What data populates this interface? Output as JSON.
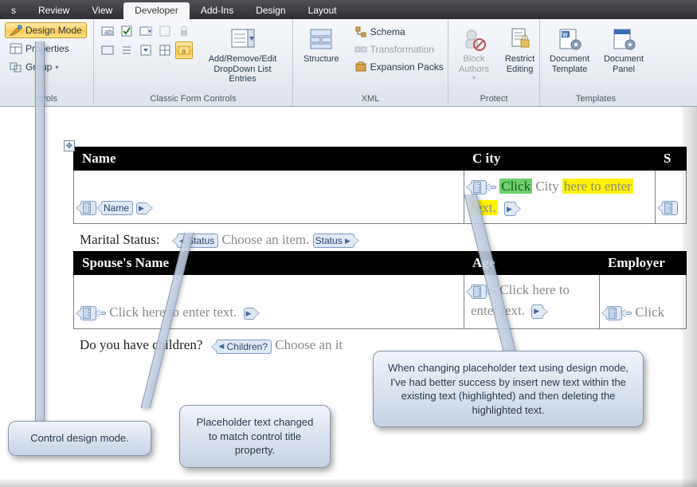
{
  "tabs": {
    "items": [
      "s",
      "Review",
      "View",
      "Developer",
      "Add-Ins",
      "Design",
      "Layout"
    ],
    "active_index": 3
  },
  "ribbon": {
    "group_controls": {
      "label": "ntrols",
      "design_mode": "Design Mode",
      "properties": "Properties",
      "group": "Group"
    },
    "group_classic": {
      "label": "Classic Form Controls",
      "big_button": "Add/Remove/Edit\nDropDown List Entries"
    },
    "group_xml": {
      "label": "XML",
      "structure": "Structure",
      "schema": "Schema",
      "transformation": "Transformation",
      "expansion": "Expansion Packs"
    },
    "group_protect": {
      "label": "Protect",
      "block": "Block\nAuthors",
      "restrict": "Restrict\nEditing"
    },
    "group_templates": {
      "label": "Templates",
      "template": "Document\nTemplate",
      "panel": "Document\nPanel"
    }
  },
  "form": {
    "headers1": [
      "Name",
      "C ity",
      "S"
    ],
    "name_tag": "Name",
    "city_click": "Click",
    "city_word": "City",
    "city_rest": "here to enter",
    "city_tail": "text.",
    "marital_label": "Marital Status:",
    "status_tag": "Status",
    "choose_item": "Choose an item.",
    "headers2": [
      "Spouse's Name",
      "Age",
      "Employer"
    ],
    "click_enter": "Click here to enter text.",
    "click_enter_wrap1": "Click here to",
    "click_enter_wrap2": "enter text.",
    "click_cut": "Click",
    "children_q": "Do you have children?",
    "children_tag": "Children?",
    "choose_cut": "Choose an it"
  },
  "callouts": {
    "c1": "Control design mode.",
    "c2": "Placeholder text changed to match control title property.",
    "c3": "When changing placeholder text using design mode, I've had better success by insert new text within the existing text (highlighted) and then deleting the highlighted text."
  }
}
